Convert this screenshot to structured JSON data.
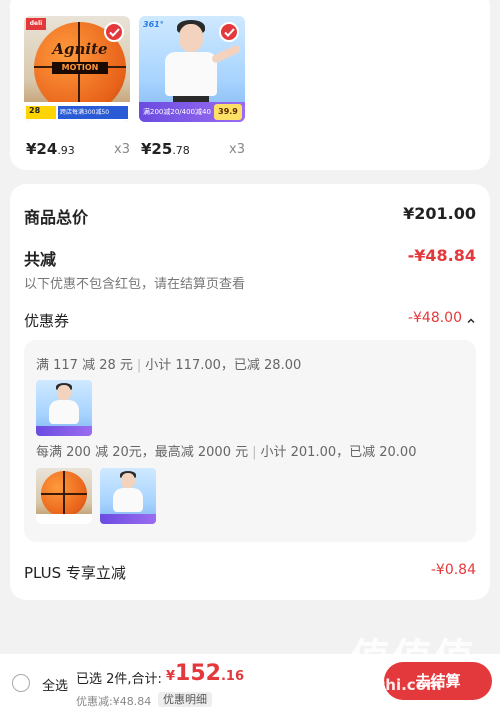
{
  "colors": {
    "accent": "#e4393c",
    "page_bg": "#f2f2f2",
    "panel_bg": "#f6f6f6"
  },
  "products": [
    {
      "name": "basketball",
      "price_int": "¥24",
      "price_dec": ".93",
      "qty": "x3",
      "thumb": {
        "brand": "Agnite",
        "logo": "deli",
        "model": "MOTION",
        "tag_price": "28",
        "strip": "跨店每满300减50"
      }
    },
    {
      "name": "tshirt",
      "price_int": "¥25",
      "price_dec": ".78",
      "qty": "x3",
      "thumb": {
        "brand": "361°",
        "strip": "满200减20/400减40",
        "tag_price": "39.9"
      }
    }
  ],
  "summary": {
    "total_label": "商品总价",
    "total_value": "¥201.00",
    "reduce_label": "共减",
    "reduce_value": "-¥48.84",
    "reduce_hint": "以下优惠不包含红包，请在结算页查看",
    "coupon_label": "优惠券",
    "coupon_value": "-¥48.00",
    "coupon_rules": [
      {
        "rule": "满 117 减 28 元",
        "detail": "小计 117.00，已减 28.00"
      },
      {
        "rule": "每满 200 减 20元，最高减 2000 元",
        "detail": "小计 201.00，已减 20.00"
      }
    ],
    "plus_label": "PLUS 专享立减",
    "plus_value": "-¥0.84"
  },
  "bottom_bar": {
    "select_all": "全选",
    "chosen": "已选 2件,合计:",
    "currency": "¥",
    "amount_int": "152",
    "amount_dec": ".16",
    "discount_line": "优惠减:¥48.84",
    "detail_button": "优惠明细",
    "checkout_button": "去结算"
  },
  "watermark": {
    "big": "值值值",
    "small": "zhizhi.com"
  }
}
